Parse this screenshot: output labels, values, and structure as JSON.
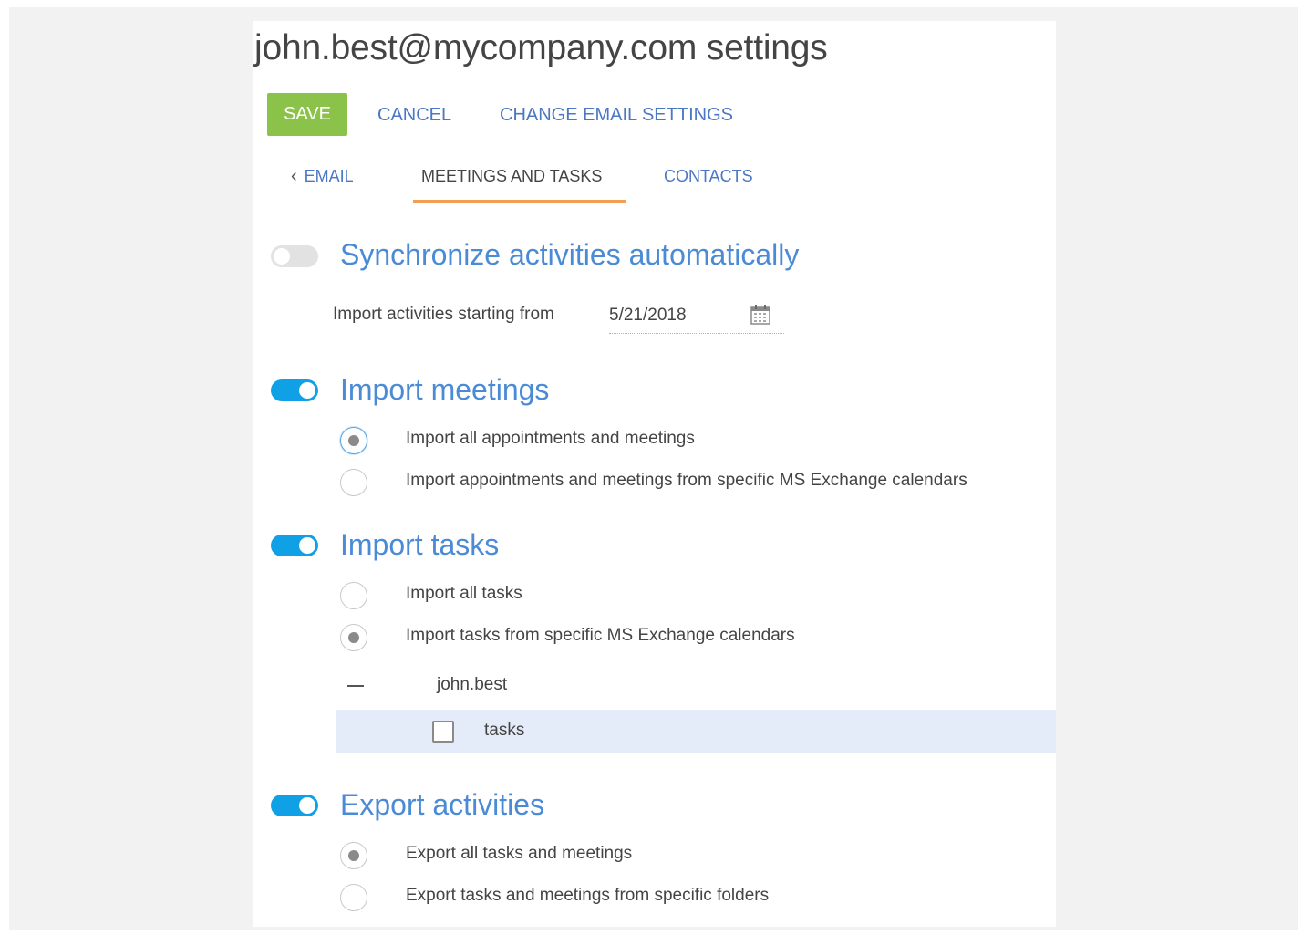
{
  "header": {
    "title": "john.best@mycompany.com settings"
  },
  "toolbar": {
    "save_label": "SAVE",
    "cancel_label": "CANCEL",
    "change_email_settings_label": "CHANGE EMAIL SETTINGS"
  },
  "tabs": [
    {
      "label": "EMAIL",
      "icon": "chevron-left-icon",
      "active": false
    },
    {
      "label": "MEETINGS AND TASKS",
      "active": true
    },
    {
      "label": "CONTACTS",
      "active": false
    }
  ],
  "colors": {
    "accent": "#4b77c4",
    "save_button": "#8bc34a",
    "toggle_on": "#10a0e6",
    "toggle_off": "#e2e2e2",
    "active_tab_underline": "#f0a050",
    "section_title": "#4b8bd6",
    "tree_highlight": "#e4ecf9"
  },
  "sync": {
    "title": "Synchronize activities automatically",
    "enabled": false,
    "import_from_label": "Import activities starting from",
    "import_from_value": "5/21/2018",
    "calendar_icon": "calendar-icon"
  },
  "meetings": {
    "title": "Import meetings",
    "enabled": true,
    "options": [
      {
        "label": "Import all appointments and meetings",
        "selected": true
      },
      {
        "label": "Import appointments and meetings from specific MS Exchange calendars",
        "selected": false
      }
    ]
  },
  "tasks": {
    "title": "Import tasks",
    "enabled": true,
    "options": [
      {
        "label": "Import all tasks",
        "selected": false
      },
      {
        "label": "Import tasks from specific MS Exchange calendars",
        "selected": true
      }
    ],
    "tree": {
      "root_label": "john.best",
      "root_expanded": true,
      "children": [
        {
          "label": "tasks",
          "checked": false
        }
      ]
    }
  },
  "export": {
    "title": "Export activities",
    "enabled": true,
    "options": [
      {
        "label": "Export all tasks and meetings",
        "selected": true
      },
      {
        "label": "Export tasks and meetings from specific folders",
        "selected": false
      }
    ]
  }
}
